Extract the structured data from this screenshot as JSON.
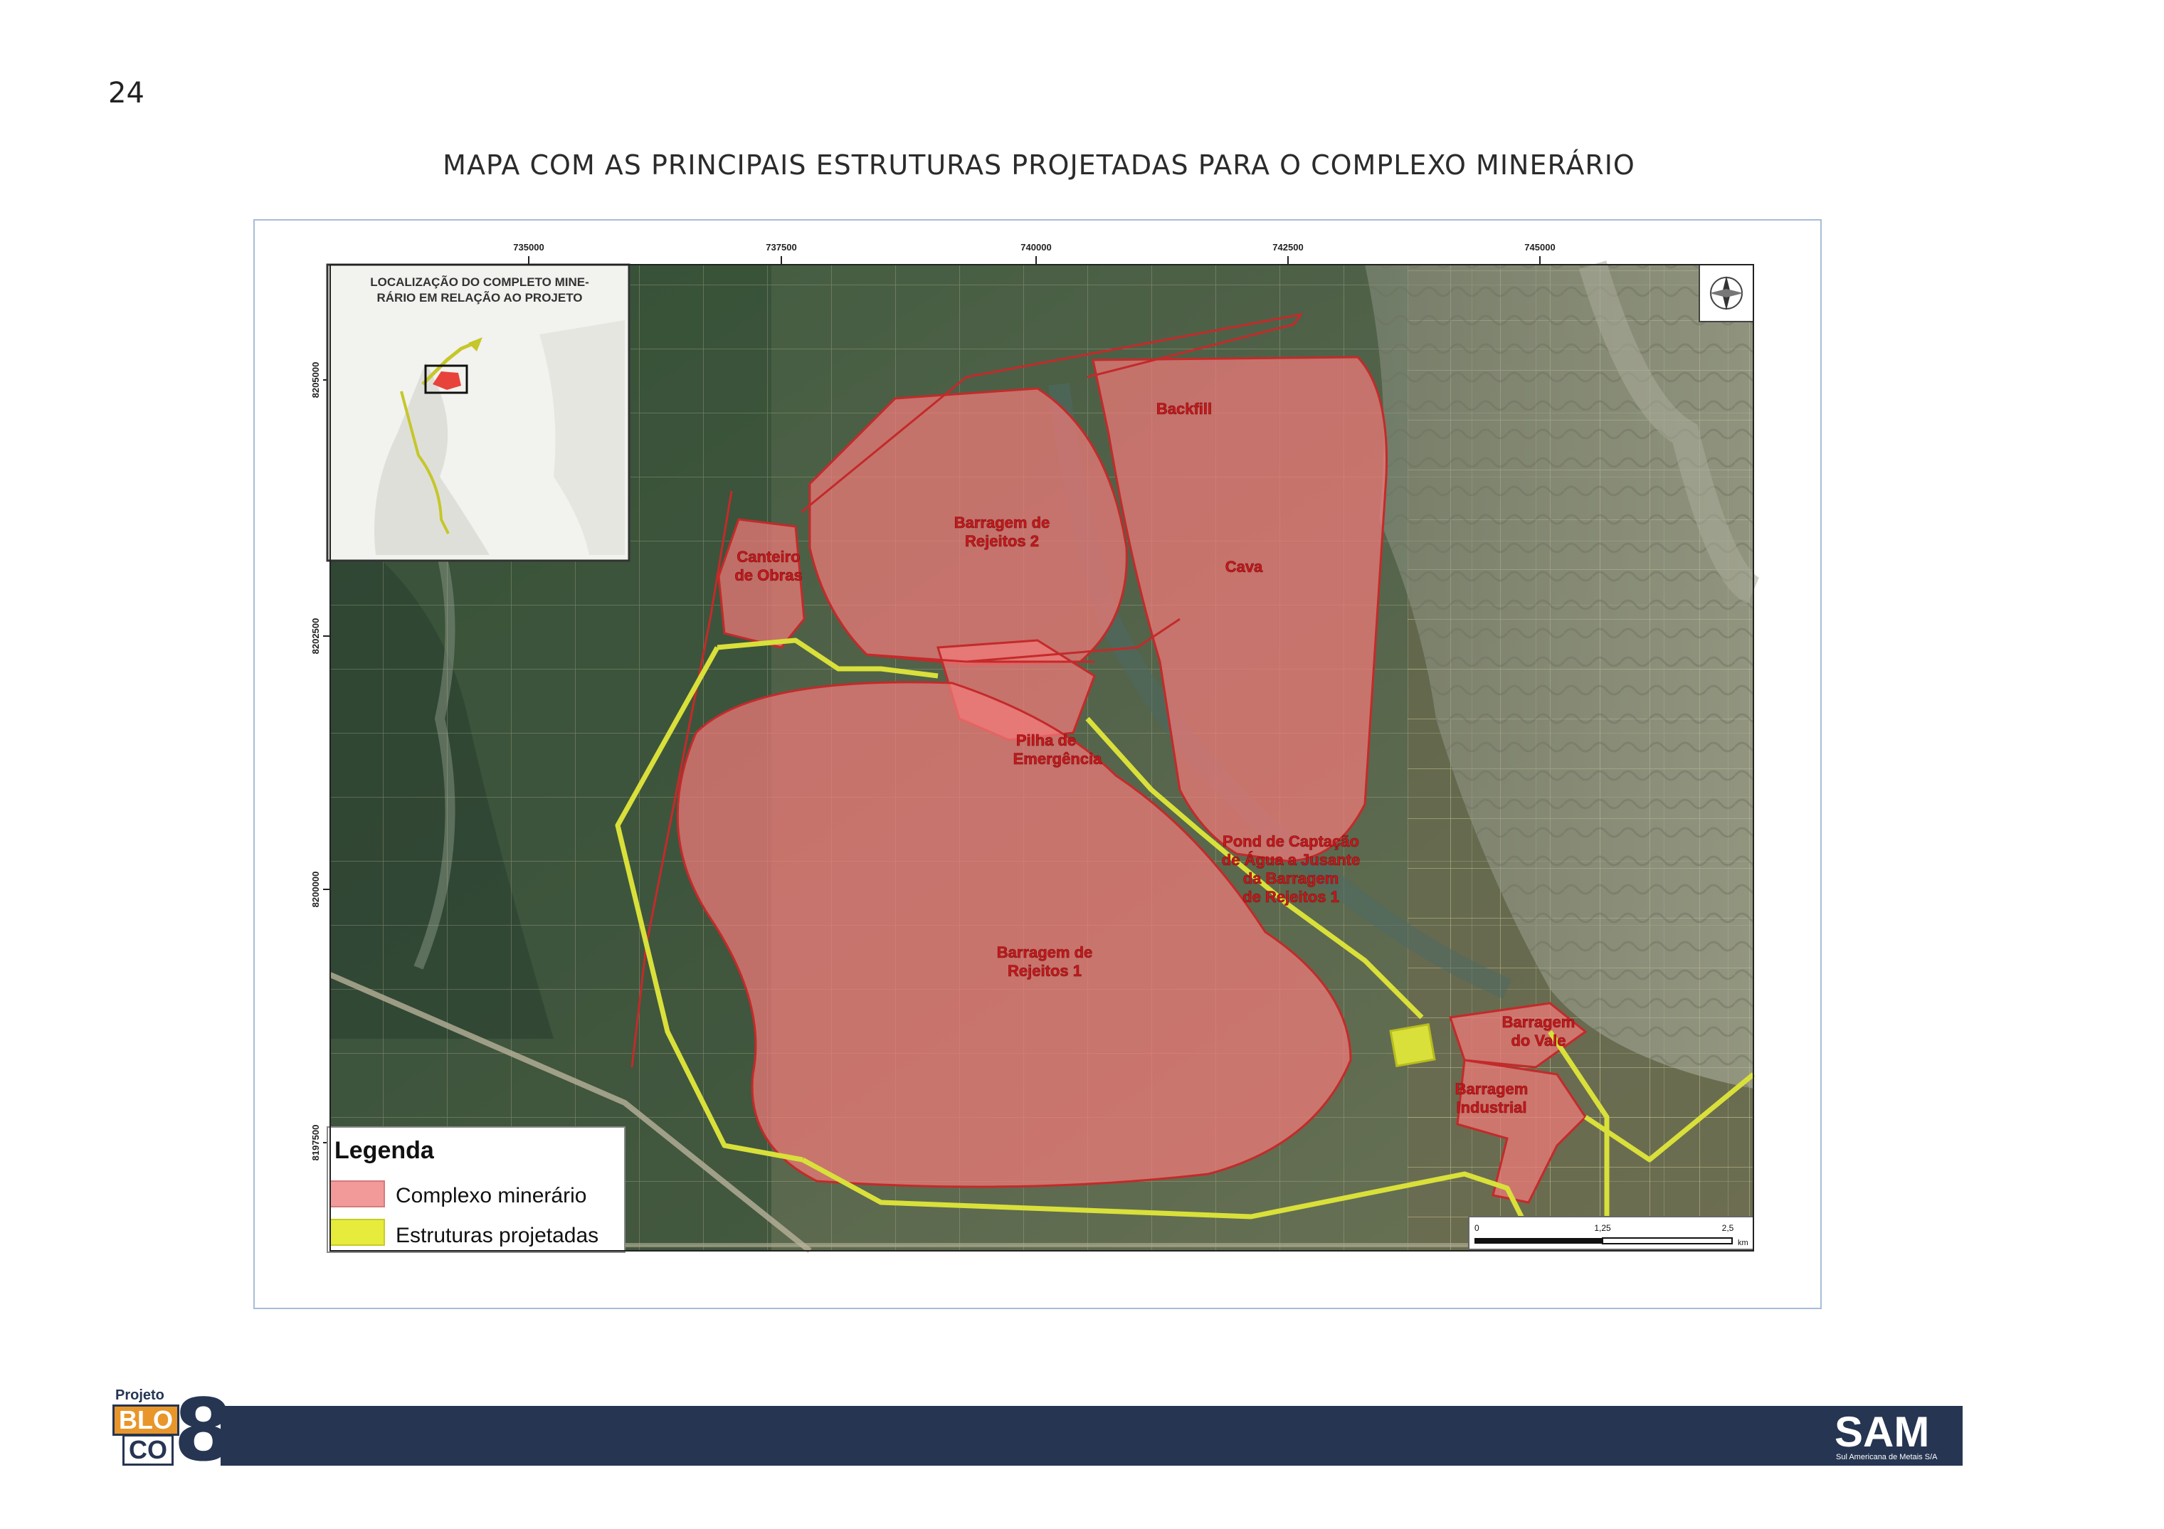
{
  "page": {
    "number": "24",
    "title": "MAPA COM AS PRINCIPAIS ESTRUTURAS PROJETADAS PARA O COMPLEXO MINERÁRIO"
  },
  "map": {
    "x_ticks": [
      "735000",
      "737500",
      "740000",
      "742500",
      "745000"
    ],
    "y_ticks": [
      "8205000",
      "8202500",
      "8200000",
      "8197500"
    ],
    "inset_title_line1": "LOCALIZAÇÃO DO COMPLETO MINE-",
    "inset_title_line2": "RÁRIO EM RELAÇÃO AO PROJETO",
    "labels": {
      "backfill": "Backfill",
      "barragem2_l1": "Barragem de",
      "barragem2_l2": "Rejeitos 2",
      "canteiro_l1": "Canteiro",
      "canteiro_l2": "de Obras",
      "cava": "Cava",
      "pilha_l1": "Pilha de",
      "pilha_l2": "Emergência",
      "pond_l1": "Pond de Captação",
      "pond_l2": "de Água a Jusante",
      "pond_l3": "da Barragem",
      "pond_l4": "de Rejeitos 1",
      "barragem1_l1": "Barragem de",
      "barragem1_l2": "Rejeitos 1",
      "vale_l1": "Barragem",
      "vale_l2": "do Vale",
      "industrial_l1": "Barragem",
      "industrial_l2": "Industrial"
    },
    "legend": {
      "title": "Legenda",
      "items": [
        {
          "label": "Complexo minerário",
          "color": "#f29a9a"
        },
        {
          "label": "Estruturas projetadas",
          "color": "#e6eb3c"
        }
      ]
    },
    "scale": {
      "ticks": [
        "0",
        "1,25",
        "2,5"
      ],
      "unit": "km"
    },
    "colors": {
      "complex_fill": "#f27a7a",
      "complex_stroke": "#c42a2a",
      "projected": "#d9e03a",
      "label_text": "#c8191d"
    }
  },
  "footer": {
    "bloco_projeto": "Projeto",
    "bloco_blo": "BLO",
    "bloco_co": "CO",
    "bloco_eight": "8",
    "sam": "SAM",
    "sam_sub": "Sul Americana de Metais S/A"
  }
}
